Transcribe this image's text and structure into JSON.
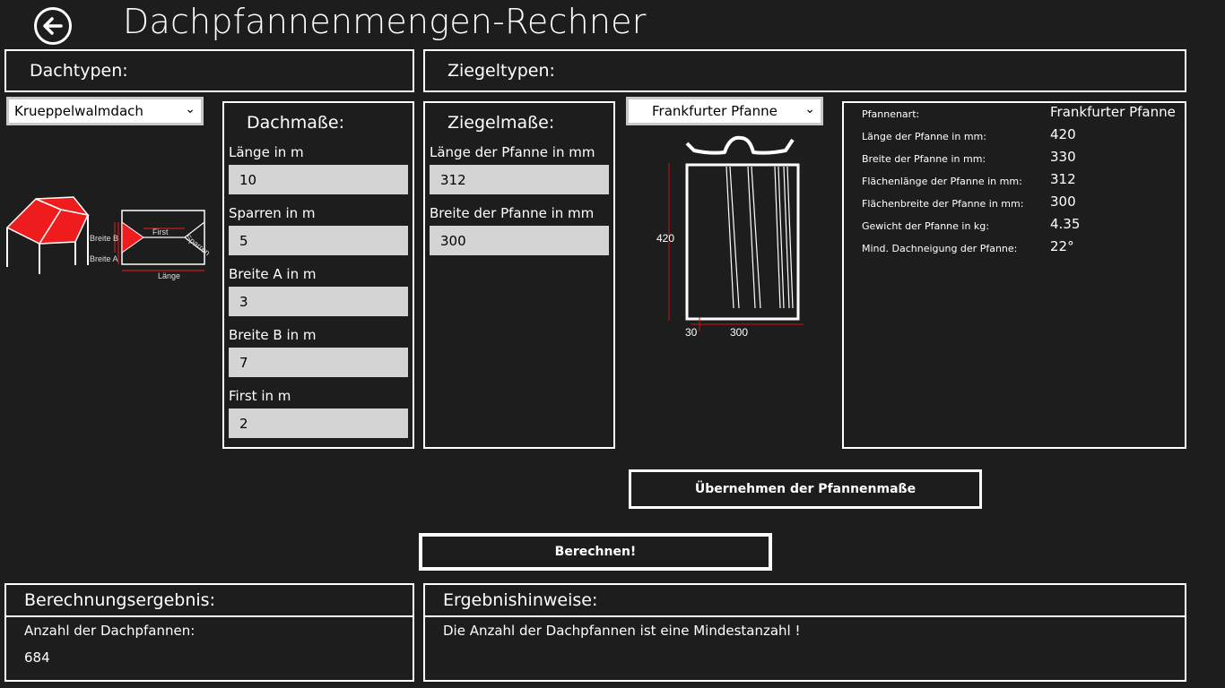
{
  "app": {
    "title": "Dachpfannenmengen-Rechner"
  },
  "dachtypen": {
    "header": "Dachtypen:",
    "selected": "Krueppelwalmdach",
    "diagram": {
      "breite_b": "Breite B",
      "breite_a": "Breite A",
      "first": "First",
      "sparren": "Sparren",
      "laenge": "Länge"
    }
  },
  "ziegeltypen": {
    "header": "Ziegeltypen:",
    "selected": "Frankfurter Pfanne"
  },
  "dachmasse": {
    "header": "Dachmaße:",
    "fields": [
      {
        "label": "Länge in m",
        "value": "10"
      },
      {
        "label": "Sparren in m",
        "value": "5"
      },
      {
        "label": "Breite A in m",
        "value": "3"
      },
      {
        "label": "Breite B in m",
        "value": "7"
      },
      {
        "label": "First in m",
        "value": "2"
      }
    ]
  },
  "ziegelmasse": {
    "header": "Ziegelmaße:",
    "fields": [
      {
        "label": "Länge der Pfanne in mm",
        "value": "312"
      },
      {
        "label": "Breite der Pfanne in mm",
        "value": "300"
      }
    ]
  },
  "tile_diagram": {
    "height": "420",
    "overlap": "30",
    "width": "300"
  },
  "pfannen_info": [
    {
      "label": "Pfannenart:",
      "value": "Frankfurter Pfanne"
    },
    {
      "label": "Länge der Pfanne in mm:",
      "value": "420"
    },
    {
      "label": "Breite der Pfanne in mm:",
      "value": "330"
    },
    {
      "label": "Flächenlänge der Pfanne in mm:",
      "value": "312"
    },
    {
      "label": "Flächenbreite der Pfanne in mm:",
      "value": "300"
    },
    {
      "label": "Gewicht der Pfanne in kg:",
      "value": "4.35"
    },
    {
      "label": "Mind. Dachneigung der Pfanne:",
      "value": "22°"
    }
  ],
  "buttons": {
    "uebernehmen": "Übernehmen der Pfannenmaße",
    "berechnen": "Berechnen!"
  },
  "ergebnis": {
    "header": "Berechnungsergebnis:",
    "label": "Anzahl der Dachpfannen:",
    "value": "684"
  },
  "hinweise": {
    "header": "Ergebnishinweise:",
    "text": "Die Anzahl der Dachpfannen ist eine Mindestanzahl !"
  }
}
